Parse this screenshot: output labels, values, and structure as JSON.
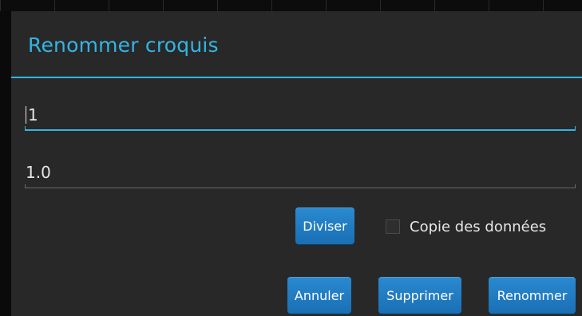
{
  "dialog": {
    "title": "Renommer croquis"
  },
  "fields": {
    "name": {
      "value": "1"
    },
    "version": {
      "value": "1.0"
    }
  },
  "actions": {
    "split_label": "Diviser",
    "copy_data_label": "Copie des données",
    "copy_data_checked": false,
    "cancel_label": "Annuler",
    "delete_label": "Supprimer",
    "rename_label": "Renommer"
  },
  "colors": {
    "accent": "#33b5e5",
    "button": "#1f7cc2",
    "dialog_bg": "#282828"
  }
}
